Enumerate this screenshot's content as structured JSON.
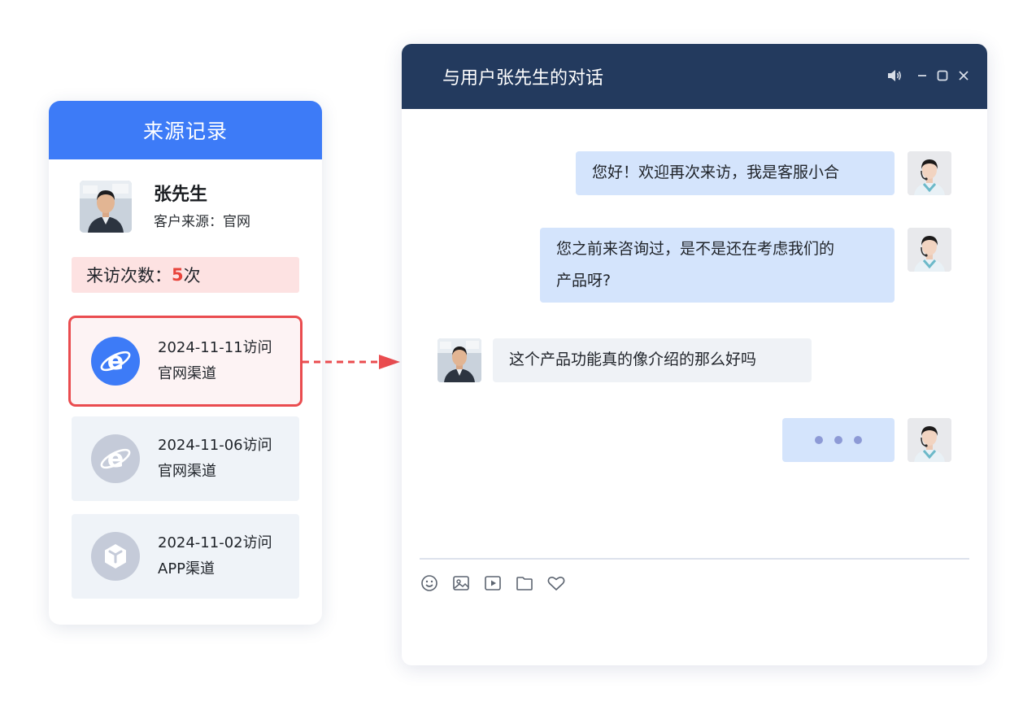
{
  "source_panel": {
    "title": "来源记录",
    "customer_name": "张先生",
    "customer_source_label": "客户来源：",
    "customer_source_value": "官网",
    "visit_count_label": "来访次数：",
    "visit_count_value": "5",
    "visit_count_unit": "次",
    "visits": [
      {
        "date": "2024-11-11访问",
        "channel": "官网渠道",
        "icon": "ie-browser-icon",
        "active": true
      },
      {
        "date": "2024-11-06访问",
        "channel": "官网渠道",
        "icon": "ie-browser-icon",
        "active": false
      },
      {
        "date": "2024-11-02访问",
        "channel": "APP渠道",
        "icon": "app-cube-icon",
        "active": false
      }
    ]
  },
  "chat": {
    "title": "与用户张先生的对话",
    "messages": [
      {
        "sender": "agent",
        "text": "您好！欢迎再次来访，我是客服小合"
      },
      {
        "sender": "agent",
        "line1": "您之前来咨询过，是不是还在考虑我们的",
        "line2": "产品呀?"
      },
      {
        "sender": "user",
        "text": "这个产品功能真的像介绍的那么好吗"
      },
      {
        "sender": "agent",
        "typing": true
      }
    ],
    "toolbar": [
      "emoji-icon",
      "image-icon",
      "video-icon",
      "folder-icon",
      "favorite-icon"
    ]
  },
  "colors": {
    "accent_blue": "#3d7bf7",
    "header_navy": "#233a5e",
    "alert_red": "#ea4c4f",
    "agent_bubble": "#d4e4fc",
    "user_bubble": "#eff2f6"
  }
}
